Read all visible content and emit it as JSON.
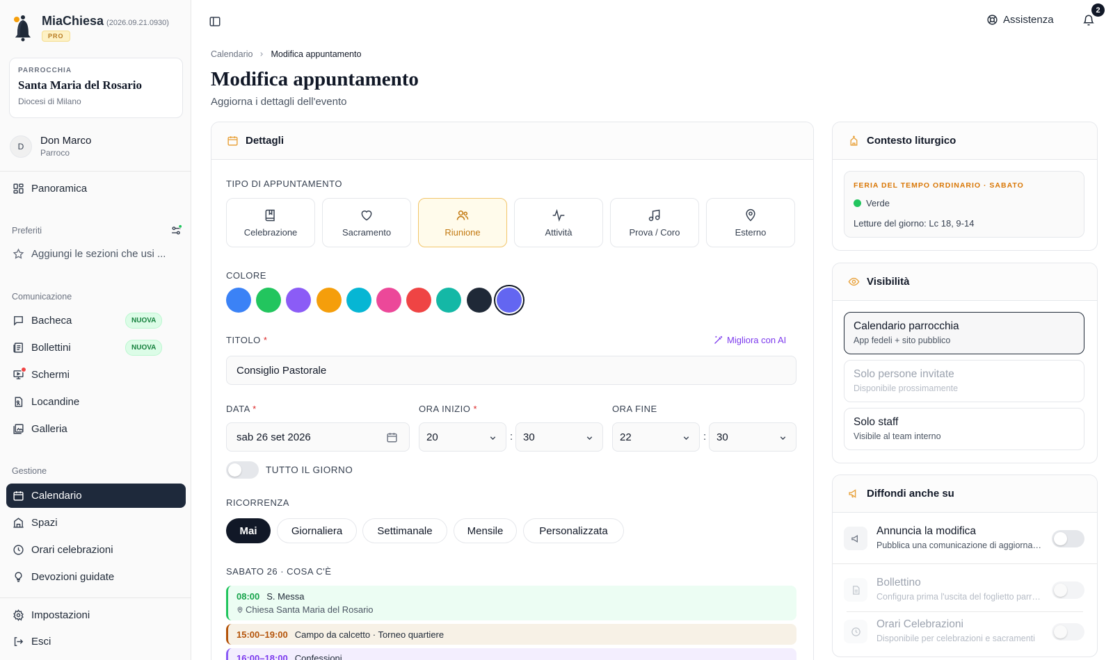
{
  "app": {
    "name": "MiaChiesa",
    "version": "(2026.09.21.0930)",
    "badge": "PRO"
  },
  "parish": {
    "label": "PARROCCHIA",
    "name": "Santa Maria del Rosario",
    "diocese": "Diocesi di Milano"
  },
  "user": {
    "initial": "D",
    "name": "Don Marco",
    "role": "Parroco"
  },
  "sidebar": {
    "overview": "Panoramica",
    "favorites_title": "Preferiti",
    "favorites_hint": "Aggiungi le sezioni che usi ...",
    "comm_title": "Comunicazione",
    "comm_items": [
      {
        "label": "Bacheca",
        "badge": "NUOVA"
      },
      {
        "label": "Bollettini",
        "badge": "NUOVA"
      },
      {
        "label": "Schermi"
      },
      {
        "label": "Locandine"
      },
      {
        "label": "Galleria"
      }
    ],
    "mgmt_title": "Gestione",
    "mgmt_items": [
      {
        "label": "Calendario"
      },
      {
        "label": "Spazi"
      },
      {
        "label": "Orari celebrazioni"
      },
      {
        "label": "Devozioni guidate"
      }
    ],
    "settings": "Impostazioni",
    "logout": "Esci"
  },
  "topbar": {
    "help": "Assistenza",
    "notifications": "2"
  },
  "breadcrumb": {
    "root": "Calendario",
    "current": "Modifica appuntamento"
  },
  "page": {
    "title": "Modifica appuntamento",
    "subtitle": "Aggiorna i dettagli dell'evento"
  },
  "details": {
    "header": "Dettagli",
    "type_label": "TIPO DI APPUNTAMENTO",
    "types": [
      {
        "label": "Celebrazione",
        "icon": "book-icon"
      },
      {
        "label": "Sacramento",
        "icon": "heart-icon"
      },
      {
        "label": "Riunione",
        "icon": "users-icon",
        "selected": true
      },
      {
        "label": "Attività",
        "icon": "activity-icon"
      },
      {
        "label": "Prova / Coro",
        "icon": "music-icon"
      },
      {
        "label": "Esterno",
        "icon": "map-pin-icon"
      }
    ],
    "color_label": "COLORE",
    "colors": [
      "#3b82f6",
      "#22c55e",
      "#8b5cf6",
      "#f59e0b",
      "#06b6d4",
      "#ec4899",
      "#ef4444",
      "#14b8a6",
      "#1f2937",
      "#6366f1"
    ],
    "selected_color": "#6366f1",
    "title_label": "TITOLO",
    "ai_label": "Migliora con AI",
    "title_value": "Consiglio Pastorale",
    "date_label": "DATA",
    "date_value": "sab 26 set 2026",
    "start_label": "ORA INIZIO",
    "start_hour": "20",
    "start_min": "30",
    "end_label": "ORA FINE",
    "end_hour": "22",
    "end_min": "30",
    "allday_label": "TUTTO IL GIORNO",
    "recurrence_label": "RICORRENZA",
    "recurrence": [
      "Mai",
      "Giornaliera",
      "Settimanale",
      "Mensile",
      "Personalizzata"
    ],
    "recurrence_selected": "Mai",
    "day_label": "SABATO 26 · COSA C'È",
    "events": [
      {
        "time": "08:00",
        "title": "S. Messa",
        "place": "Chiesa Santa Maria del Rosario",
        "color": "#16a34a"
      },
      {
        "time": "15:00–19:00",
        "title": "Campo da calcetto · Torneo quartiere",
        "color": "#b45309"
      },
      {
        "time": "16:00–18:00",
        "title": "Confessioni",
        "color": "#7c3aed"
      }
    ]
  },
  "liturgy": {
    "header": "Contesto liturgico",
    "day": "FERIA DEL TEMPO ORDINARIO · SABATO",
    "color_name": "Verde",
    "color": "#22c55e",
    "readings": "Letture del giorno: Lc 18, 9-14"
  },
  "visibility": {
    "header": "Visibilità",
    "options": [
      {
        "title": "Calendario parrocchia",
        "sub": "App fedeli + sito pubblico"
      },
      {
        "title": "Solo persone invitate",
        "sub": "Disponibile prossimamente"
      },
      {
        "title": "Solo staff",
        "sub": "Visibile al team interno"
      }
    ]
  },
  "spread": {
    "header": "Diffondi anche su",
    "items": [
      {
        "title": "Annuncia la modifica",
        "sub": "Pubblica una comunicazione di aggiornamento"
      },
      {
        "title": "Bollettino",
        "sub": "Configura prima l'uscita del foglietto parrocchiale"
      },
      {
        "title": "Orari Celebrazioni",
        "sub": "Disponibile per celebrazioni e sacramenti"
      }
    ]
  }
}
